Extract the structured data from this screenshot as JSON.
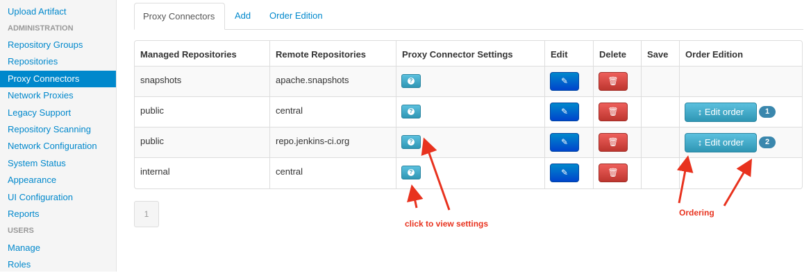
{
  "sidebar": {
    "items_top": [
      "Upload Artifact"
    ],
    "header_admin": "ADMINISTRATION",
    "items_admin": [
      "Repository Groups",
      "Repositories",
      "Proxy Connectors",
      "Network Proxies",
      "Legacy Support",
      "Repository Scanning",
      "Network Configuration",
      "System Status",
      "Appearance",
      "UI Configuration",
      "Reports"
    ],
    "active": "Proxy Connectors",
    "header_users": "USERS",
    "items_users": [
      "Manage",
      "Roles"
    ]
  },
  "tabs": [
    "Proxy Connectors",
    "Add",
    "Order Edition"
  ],
  "table": {
    "headers": [
      "Managed Repositories",
      "Remote Repositories",
      "Proxy Connector Settings",
      "Edit",
      "Delete",
      "Save",
      "Order Edition"
    ],
    "rows": [
      {
        "managed": "snapshots",
        "remote": "apache.snapshots",
        "order": null
      },
      {
        "managed": "public",
        "remote": "central",
        "order": "1"
      },
      {
        "managed": "public",
        "remote": "repo.jenkins-ci.org",
        "order": "2"
      },
      {
        "managed": "internal",
        "remote": "central",
        "order": null
      }
    ],
    "edit_order_label": "Edit order"
  },
  "pagination": {
    "current": "1"
  },
  "annotations": {
    "settings": "click to view settings",
    "ordering": "Ordering"
  },
  "colors": {
    "accent": "#0088cc",
    "danger": "#bd362f",
    "info": "#2f96b4",
    "annotation": "#e8321e"
  }
}
